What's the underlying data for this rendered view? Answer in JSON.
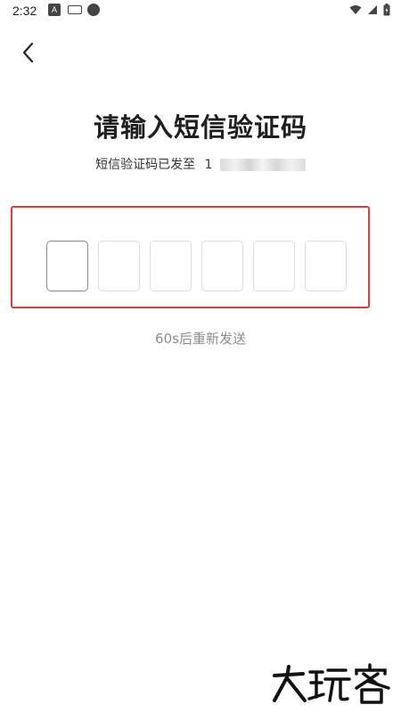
{
  "status_bar": {
    "time": "2:32",
    "icons": [
      "font-a-icon",
      "keyboard-icon",
      "link-icon"
    ],
    "right_icons": [
      "wifi-icon",
      "signal-icon",
      "battery-icon"
    ]
  },
  "header": {
    "back_icon": "chevron-left-icon"
  },
  "main": {
    "title": "请输入短信验证码",
    "subtitle_prefix": "短信验证码已发至",
    "phone_visible_prefix": "1",
    "code_length": 6,
    "resend_text": "60s后重新发送"
  },
  "watermark": {
    "text": "大玩客"
  },
  "colors": {
    "highlight_border": "#e23a3a",
    "title": "#1f1f1f",
    "muted": "#8c8c8c"
  }
}
